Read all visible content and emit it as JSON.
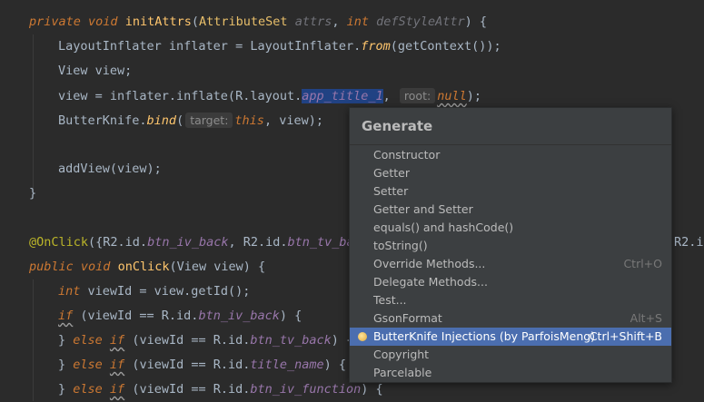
{
  "code": {
    "l1": {
      "kw1": "private",
      "kw2": "void",
      "fn": "initAttrs",
      "p1": "(",
      "cls": "AttributeSet",
      "sp1": " ",
      "param1": "attrs",
      "comma": ", ",
      "kw3": "int",
      "sp2": " ",
      "param2": "defStyleAttr",
      "end": ") {"
    },
    "l2": {
      "t1": "LayoutInflater inflater = LayoutInflater.",
      "st": "from",
      "t2": "(getContext());"
    },
    "l3": {
      "t1": "View view;"
    },
    "l4": {
      "t1": "view = inflater.inflate(R.layout.",
      "sel": "app_title_1",
      "comma": ",",
      "hint": "root:",
      "wavy": "null",
      "end": ");"
    },
    "l5": {
      "t1": "ButterKnife.",
      "st": "bind",
      "p": "(",
      "hint": "target:",
      "kw": "this",
      "end": ", view);"
    },
    "l6": {
      "t1": "addView(view);"
    },
    "l7": {
      "t1": "}"
    },
    "l8": {
      "ann": "@OnClick",
      "t1": "({R2.id.",
      "f1": "btn_iv_back",
      "t2": ", R2.id.",
      "f2": "btn_tv_ba",
      "tail": "R2.i"
    },
    "l9": {
      "kw1": "public",
      "kw2": "void",
      "fn": "onClick",
      "t1": "(View view) {"
    },
    "l10": {
      "kw": "int",
      "t1": " viewId = view.getId();"
    },
    "l11": {
      "kw": "if",
      "t1": " (viewId == R.id.",
      "f": "btn_iv_back",
      "end": ") {"
    },
    "l12": {
      "b": "} ",
      "kw1": "else",
      "kw2": "if",
      "t1": " (viewId == R.id.",
      "f": "btn_tv_back",
      "end": ") {"
    },
    "l13": {
      "b": "} ",
      "kw1": "else",
      "kw2": "if",
      "t1": " (viewId == R.id.",
      "f": "title_name",
      "end": ") {"
    },
    "l14": {
      "b": "} ",
      "kw1": "else",
      "kw2": "if",
      "t1": " (viewId == R.id.",
      "f": "btn_iv_function",
      "end": ") {"
    }
  },
  "generate": {
    "title": "Generate",
    "items": [
      {
        "label": "Constructor",
        "shortcut": ""
      },
      {
        "label": "Getter",
        "shortcut": ""
      },
      {
        "label": "Setter",
        "shortcut": ""
      },
      {
        "label": "Getter and Setter",
        "shortcut": ""
      },
      {
        "label": "equals() and hashCode()",
        "shortcut": ""
      },
      {
        "label": "toString()",
        "shortcut": ""
      },
      {
        "label": "Override Methods...",
        "shortcut": "Ctrl+O"
      },
      {
        "label": "Delegate Methods...",
        "shortcut": ""
      },
      {
        "label": "Test...",
        "shortcut": ""
      },
      {
        "label": "GsonFormat",
        "shortcut": "Alt+S"
      },
      {
        "label": "ButterKnife Injections (by ParfoisMeng)",
        "shortcut": "Ctrl+Shift+B"
      },
      {
        "label": "Copyright",
        "shortcut": ""
      },
      {
        "label": "Parcelable",
        "shortcut": ""
      }
    ],
    "selected_index": 10
  },
  "colors": {
    "background": "#2b2b2b",
    "keyword": "#cc7832",
    "method": "#ffc66d",
    "field": "#9876aa",
    "selection": "#4b6eaf"
  }
}
